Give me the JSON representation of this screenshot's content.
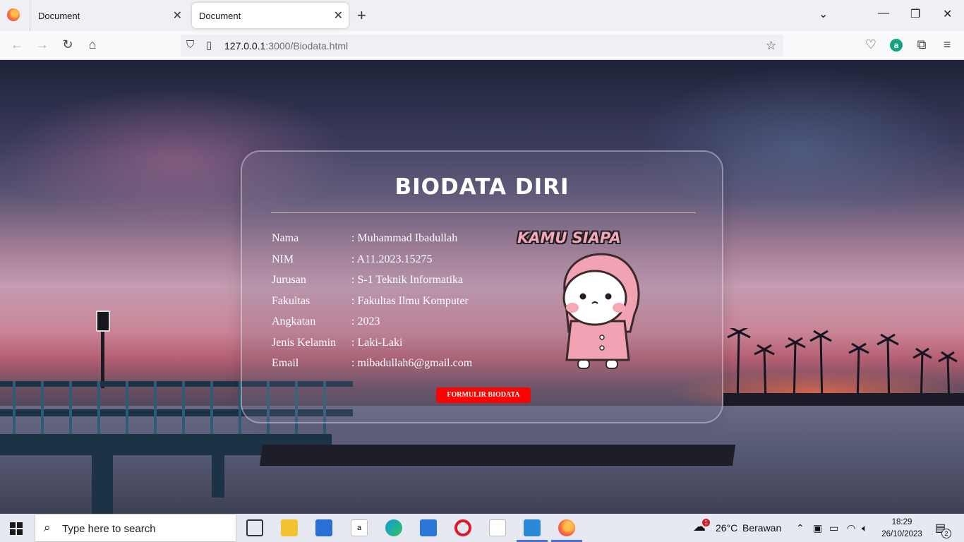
{
  "browser": {
    "tabs": [
      {
        "label": "Document",
        "active": false
      },
      {
        "label": "Document",
        "active": true
      }
    ],
    "url_host": "127.0.0.1",
    "url_rest": ":3000/Biodata.html"
  },
  "card": {
    "title": "BIODATA DIRI",
    "rows": [
      {
        "label": "Nama",
        "value": ": Muhammad Ibadullah"
      },
      {
        "label": "NIM",
        "value": ": A11.2023.15275"
      },
      {
        "label": "Jurusan",
        "value": ": S-1 Teknik Informatika"
      },
      {
        "label": "Fakultas",
        "value": ": Fakultas Ilmu Komputer"
      },
      {
        "label": "Angkatan",
        "value": ": 2023"
      },
      {
        "label": "Jenis Kelamin",
        "value": ": Laki-Laki"
      },
      {
        "label": "Email",
        "value": ": mibadullah6@gmail.com"
      }
    ],
    "button_label": "FORMULIR BIODATA",
    "sticker_text": "KAMU SIAPA"
  },
  "taskbar": {
    "search_placeholder": "Type here to search",
    "weather_temp": "26°C",
    "weather_desc": "Berawan",
    "weather_badge": "1",
    "time": "18:29",
    "date": "26/10/2023",
    "notification_count": "2"
  },
  "colors": {
    "button_red": "#ff0000",
    "accent_blue": "#4c6fd8"
  }
}
